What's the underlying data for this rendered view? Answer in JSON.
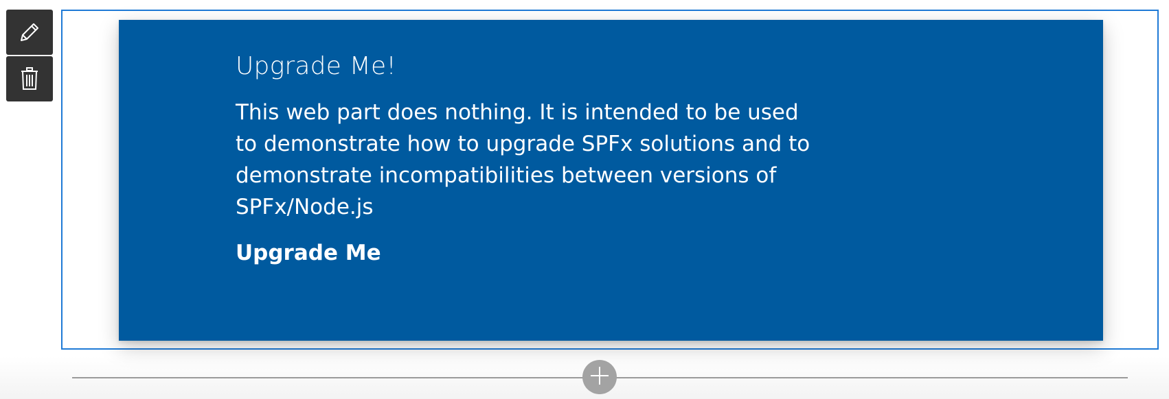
{
  "toolbar": {
    "edit_icon": "pencil-icon",
    "delete_icon": "trash-icon"
  },
  "webpart": {
    "title": "Upgrade Me!",
    "description": "This web part does nothing. It is intended to be used to demonstrate how to upgrade SPFx solutions and to demonstrate incompatibilities between versions of SPFx/Node.js",
    "action_label": "Upgrade Me"
  },
  "section": {
    "add_icon": "plus-icon"
  },
  "colors": {
    "card_background": "#005a9f",
    "selection_border": "#1f7ad6",
    "toolbar_background": "#333333"
  }
}
